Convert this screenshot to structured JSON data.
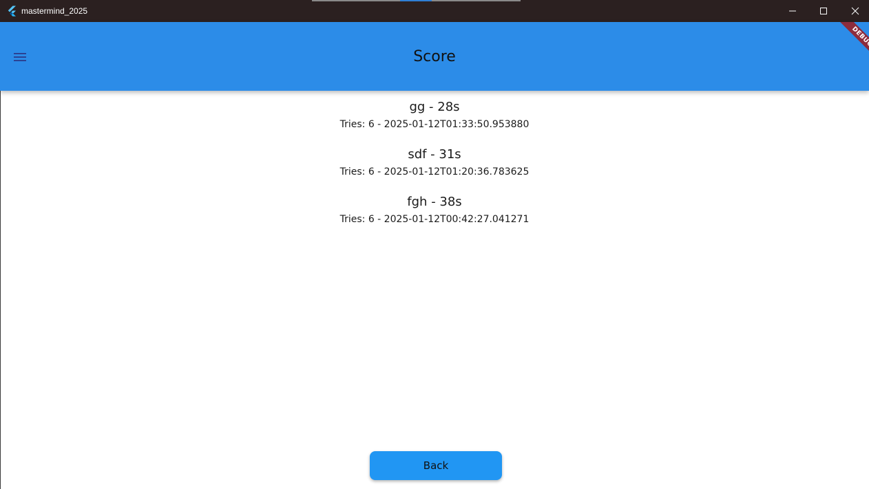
{
  "window": {
    "title": "mastermind_2025",
    "icon": "flutter-logo-icon"
  },
  "appbar": {
    "title": "Score",
    "menu_icon": "hamburger-menu-icon",
    "debug_label": "DEBUG"
  },
  "scores": [
    {
      "name_time": "gg - 28s",
      "detail": "Tries: 6 - 2025-01-12T01:33:50.953880"
    },
    {
      "name_time": "sdf - 31s",
      "detail": "Tries: 6 - 2025-01-12T01:20:36.783625"
    },
    {
      "name_time": "fgh - 38s",
      "detail": "Tries: 6 - 2025-01-12T00:42:27.041271"
    }
  ],
  "back_button": {
    "label": "Back"
  },
  "colors": {
    "appbar": "#2c8ce8",
    "button": "#2196f3",
    "titlebar": "#2b2020",
    "debug_banner": "#8d2c3c"
  }
}
